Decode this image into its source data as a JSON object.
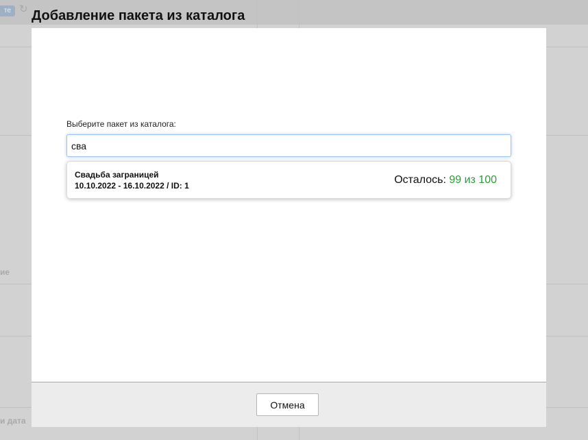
{
  "background": {
    "top_button_label": "те",
    "side_label_1": "ие",
    "side_label_2": "и дата"
  },
  "modal": {
    "title": "Добавление пакета из каталога",
    "field_label": "Выберите пакет из каталога:",
    "search_value": "сва",
    "results": [
      {
        "name": "Свадьба заграницей",
        "dates_id": "10.10.2022 - 16.10.2022 / ID: 1",
        "remaining_label": "Осталось:",
        "remaining_value": "99 из 100"
      }
    ],
    "cancel_label": "Отмена"
  },
  "colors": {
    "remaining_value": "#2e9a3c",
    "input_focus_border": "#9ec3ec"
  },
  "icons": {
    "refresh": "refresh-icon"
  }
}
